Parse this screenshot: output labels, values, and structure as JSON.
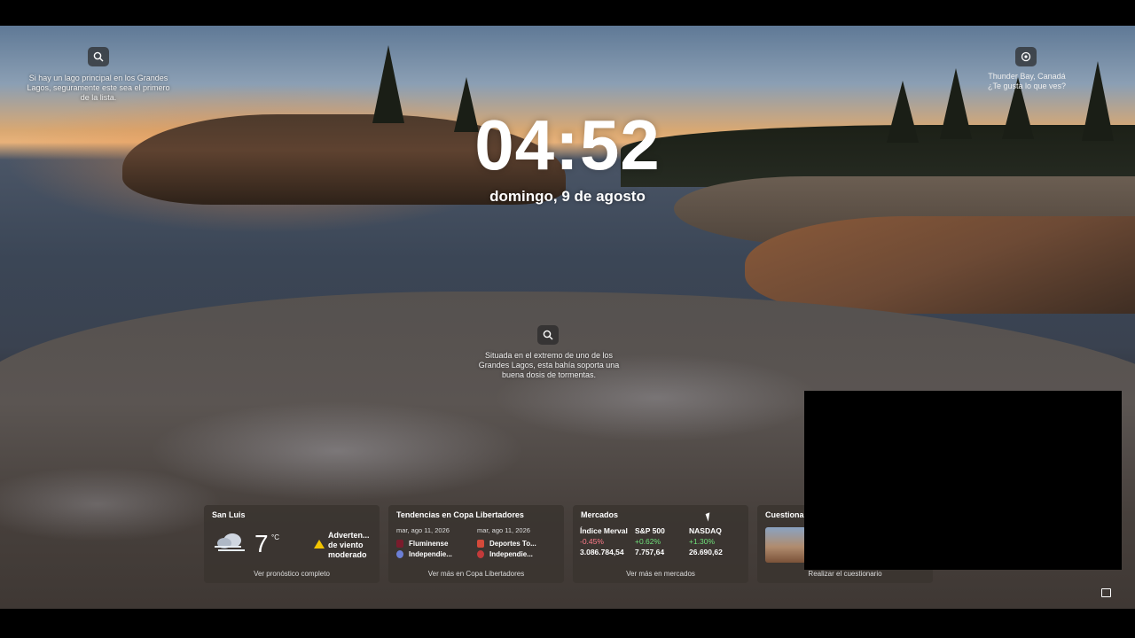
{
  "clock": {
    "time": "04:52",
    "date": "domingo, 9 de agosto"
  },
  "facts": {
    "top_left": "Si hay un lago principal en los Grandes Lagos, seguramente este sea el primero de la lista.",
    "center": "Situada en el extremo de uno de los Grandes Lagos, esta bahía soporta una buena dosis de tormentas."
  },
  "location": {
    "name": "Thunder Bay, Canadá",
    "prompt": "¿Te gusta lo que ves?"
  },
  "widgets": {
    "weather": {
      "title": "San Luis",
      "temp": "7",
      "unit": "°C",
      "warning_line1": "Adverten...",
      "warning_line2": "de viento",
      "warning_line3": "moderado",
      "footer": "Ver pronóstico completo"
    },
    "sports": {
      "title": "Tendencias en Copa Libertadores",
      "matches": [
        {
          "date": "mar, ago 11, 2026",
          "team1": "Fluminense",
          "team2": "Independie..."
        },
        {
          "date": "mar, ago 11, 2026",
          "team1": "Deportes To...",
          "team2": "Independie..."
        }
      ],
      "footer": "Ver más en Copa Libertadores"
    },
    "markets": {
      "title": "Mercados",
      "items": [
        {
          "name": "Índice Merval",
          "change": "-0.45%",
          "value": "3.086.784,54"
        },
        {
          "name": "S&P 500",
          "change": "+0.62%",
          "value": "7.757,64"
        },
        {
          "name": "NASDAQ",
          "change": "+1.30%",
          "value": "26.690,62"
        }
      ],
      "footer": "Ver más en mercados"
    },
    "quiz": {
      "title": "Cuestionar",
      "footer": "Realizar el cuestionario"
    }
  },
  "colors": {
    "negative": "#ff7a8a",
    "positive": "#6fe07a",
    "warning": "#f2c400"
  },
  "icons": [
    "search-icon",
    "location-icon",
    "cloud-wind-icon",
    "warning-icon",
    "screen-icon"
  ]
}
